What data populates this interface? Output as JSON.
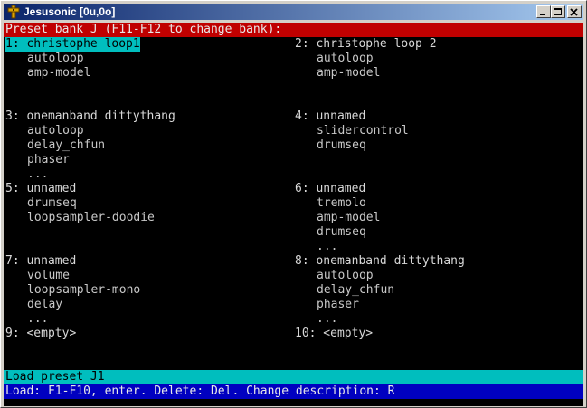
{
  "window": {
    "title": "Jesusonic [0u,0o]",
    "icon": "cross-icon",
    "controls": [
      "minimize-icon",
      "maximize-icon",
      "close-icon"
    ]
  },
  "header": {
    "text": "Preset bank J (F11-F12 to change bank):"
  },
  "presets": [
    {
      "label": "1: christophe loop1",
      "selected": true,
      "modules": [
        "autoloop",
        "amp-model"
      ]
    },
    {
      "label": "2: christophe loop 2",
      "selected": false,
      "modules": [
        "autoloop",
        "amp-model"
      ]
    },
    {
      "label": "3: onemanband dittythang",
      "selected": false,
      "modules": [
        "autoloop",
        "delay_chfun",
        "phaser",
        "..."
      ]
    },
    {
      "label": "4: unnamed",
      "selected": false,
      "modules": [
        "slidercontrol",
        "drumseq"
      ]
    },
    {
      "label": "5: unnamed",
      "selected": false,
      "modules": [
        "drumseq",
        "loopsampler-doodie"
      ]
    },
    {
      "label": "6: unnamed",
      "selected": false,
      "modules": [
        "tremolo",
        "amp-model",
        "drumseq",
        "..."
      ]
    },
    {
      "label": "7: unnamed",
      "selected": false,
      "modules": [
        "volume",
        "loopsampler-mono",
        "delay",
        "..."
      ]
    },
    {
      "label": "8: onemanband dittythang",
      "selected": false,
      "modules": [
        "autoloop",
        "delay_chfun",
        "phaser",
        "..."
      ]
    },
    {
      "label": "9: <empty>",
      "selected": false,
      "modules": []
    },
    {
      "label": "10: <empty>",
      "selected": false,
      "modules": []
    }
  ],
  "status": {
    "text": "Load preset J1"
  },
  "help": {
    "text": "Load: F1-F10, enter. Delete: Del. Change description: R"
  },
  "colors": {
    "header_bg": "#c00000",
    "selected_bg": "#00bebe",
    "help_bg": "#0000c0",
    "background": "#000000"
  }
}
